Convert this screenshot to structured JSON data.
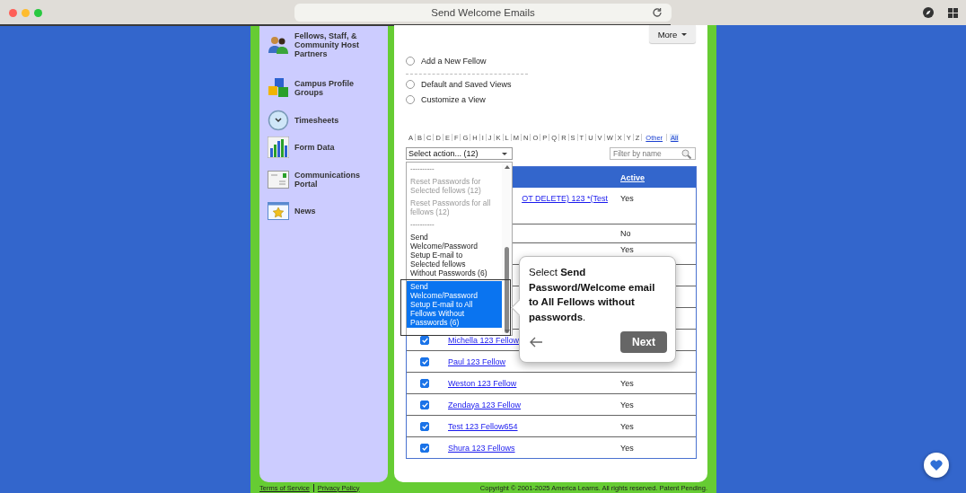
{
  "browser": {
    "title": "Send Welcome Emails"
  },
  "sidebar": {
    "items": [
      {
        "label": "Fellows, Staff, & Community Host Partners"
      },
      {
        "label": "Campus Profile Groups"
      },
      {
        "label": "Timesheets"
      },
      {
        "label": "Form Data"
      },
      {
        "label": "Communications Portal"
      },
      {
        "label": "News"
      }
    ]
  },
  "more_button": "More",
  "primary_options": [
    {
      "label": "Add a New Fellow",
      "selected": false
    }
  ],
  "view_options": [
    {
      "label": "Default and Saved Views",
      "selected": false
    },
    {
      "label": "Customize a View",
      "selected": false
    }
  ],
  "alphabet": [
    {
      "label": "A",
      "kind": "letter",
      "selected": false
    },
    {
      "label": "B",
      "kind": "letter",
      "selected": false
    },
    {
      "label": "C",
      "kind": "letter",
      "selected": false
    },
    {
      "label": "D",
      "kind": "letter",
      "selected": false
    },
    {
      "label": "E",
      "kind": "letter",
      "selected": false
    },
    {
      "label": "F",
      "kind": "letter",
      "selected": false
    },
    {
      "label": "G",
      "kind": "letter",
      "selected": false
    },
    {
      "label": "H",
      "kind": "letter",
      "selected": false
    },
    {
      "label": "I",
      "kind": "letter",
      "selected": false
    },
    {
      "label": "J",
      "kind": "letter",
      "selected": false
    },
    {
      "label": "K",
      "kind": "letter",
      "selected": false
    },
    {
      "label": "L",
      "kind": "letter",
      "selected": false
    },
    {
      "label": "M",
      "kind": "letter",
      "selected": false
    },
    {
      "label": "N",
      "kind": "letter",
      "selected": false
    },
    {
      "label": "O",
      "kind": "letter",
      "selected": false
    },
    {
      "label": "P",
      "kind": "letter",
      "selected": false
    },
    {
      "label": "Q",
      "kind": "letter",
      "selected": false
    },
    {
      "label": "R",
      "kind": "letter",
      "selected": false
    },
    {
      "label": "S",
      "kind": "letter",
      "selected": false
    },
    {
      "label": "T",
      "kind": "letter",
      "selected": false
    },
    {
      "label": "U",
      "kind": "letter",
      "selected": false
    },
    {
      "label": "V",
      "kind": "letter",
      "selected": false
    },
    {
      "label": "W",
      "kind": "letter",
      "selected": false
    },
    {
      "label": "X",
      "kind": "letter",
      "selected": false
    },
    {
      "label": "Y",
      "kind": "letter",
      "selected": false
    },
    {
      "label": "Z",
      "kind": "letter",
      "selected": false
    },
    {
      "label": "Other",
      "kind": "link",
      "selected": false
    },
    {
      "label": "All",
      "kind": "link",
      "selected": true
    }
  ],
  "action_select": {
    "value": "Select action... (12)",
    "options": [
      {
        "label": "----------",
        "kind": "separator",
        "disabled": false,
        "selected": false
      },
      {
        "label": "Reset Passwords for Selected fellows (12)",
        "kind": "option",
        "disabled": true,
        "selected": false
      },
      {
        "label": "Reset Passwords for all fellows (12)",
        "kind": "option",
        "disabled": true,
        "selected": false
      },
      {
        "label": "----------",
        "kind": "separator",
        "disabled": false,
        "selected": false
      },
      {
        "label": "Send Welcome/Password Setup E-mail to Selected fellows Without Passwords (6)",
        "kind": "option",
        "disabled": false,
        "selected": false
      },
      {
        "label": "Send Welcome/Password Setup E-mail to All Fellows Without Passwords (6)",
        "kind": "option",
        "disabled": false,
        "selected": true
      }
    ]
  },
  "filter": {
    "placeholder": "Filter by name"
  },
  "table": {
    "columns": [
      "Active"
    ],
    "rows": [
      {
        "name": "OT DELETE) 123 *(Test",
        "active": "Yes"
      },
      {
        "active": "No"
      },
      {
        "active": "Yes"
      },
      {},
      {},
      {},
      {
        "checked": true,
        "name": "Michella 123 Fellow"
      },
      {
        "checked": true,
        "name": "Paul 123 Fellow"
      },
      {
        "checked": true,
        "name": "Weston 123 Fellow",
        "active": "Yes"
      },
      {
        "checked": true,
        "name": "Zendaya 123 Fellow",
        "active": "Yes"
      },
      {
        "checked": true,
        "name": "Test 123 Fellow654",
        "active": "Yes"
      },
      {
        "checked": true,
        "name": "Shura 123 Fellows",
        "active": "Yes"
      }
    ]
  },
  "tour_tip": {
    "text": "Select **Send Password/Welcome email to All Fellows without passwords**.",
    "next_button": "Next"
  },
  "footer": {
    "links": [
      "Terms of Service",
      "Privacy Policy"
    ],
    "copyright": "Copyright © 2001-2025 America Learns. All rights reserved. Patent Pending."
  }
}
